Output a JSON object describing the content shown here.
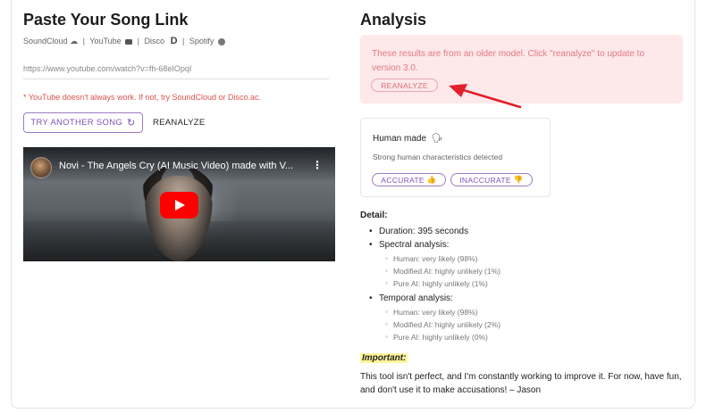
{
  "left": {
    "title": "Paste Your Song Link",
    "sources": {
      "soundcloud": "SoundCloud",
      "youtube": "YouTube",
      "disco": "Disco",
      "spotify": "Spotify",
      "separator": "|"
    },
    "url_value": "https://www.youtube.com/watch?v=fh-68eIOpqI",
    "warning": "* YouTube doesn't always work. If not, try SoundCloud or Disco.ac.",
    "try_another_label": "TRY ANOTHER SONG",
    "reanalyze_label": "REANALYZE",
    "video": {
      "title": "Novi - The Angels Cry (AI Music Video) made with V..."
    }
  },
  "right": {
    "title": "Analysis",
    "alert": {
      "message": "These results are from an older model. Click \"reanalyze\" to update to version 3.0.",
      "button_label": "REANALYZE"
    },
    "verdict": {
      "title": "Human made",
      "subtitle": "Strong human characteristics detected",
      "accurate_label": "ACCURATE",
      "inaccurate_label": "INACCURATE"
    },
    "detail_heading": "Detail:",
    "details": {
      "duration": "Duration: 395 seconds",
      "spectral": {
        "heading": "Spectral analysis:",
        "items": [
          "Human: very likely (98%)",
          "Modified AI: highly unlikely (1%)",
          "Pure AI: highly unlikely (1%)"
        ]
      },
      "temporal": {
        "heading": "Temporal analysis:",
        "items": [
          "Human: very likely (98%)",
          "Modified AI: highly unlikely (2%)",
          "Pure AI: highly unlikely (0%)"
        ]
      }
    },
    "important_label": "Important:",
    "closing_text": "This tool isn't perfect, and I'm constantly working to improve it. For now, have fun, and don't use it to make accusations! – Jason"
  },
  "colors": {
    "accent_purple": "#7d52b8",
    "alert_bg": "#fde8ea",
    "alert_text": "#e07a82",
    "warning_red": "#d9534f",
    "arrow_red": "#e0202a",
    "highlight_yellow": "#fff59a"
  },
  "icons": {
    "soundcloud": "cloud-icon",
    "youtube": "youtube-icon",
    "disco": "disco-d-icon",
    "spotify": "spotify-icon",
    "refresh": "refresh-icon",
    "human": "person-voice-icon",
    "thumbs_up": "thumbs-up-icon",
    "thumbs_down": "thumbs-down-icon"
  }
}
